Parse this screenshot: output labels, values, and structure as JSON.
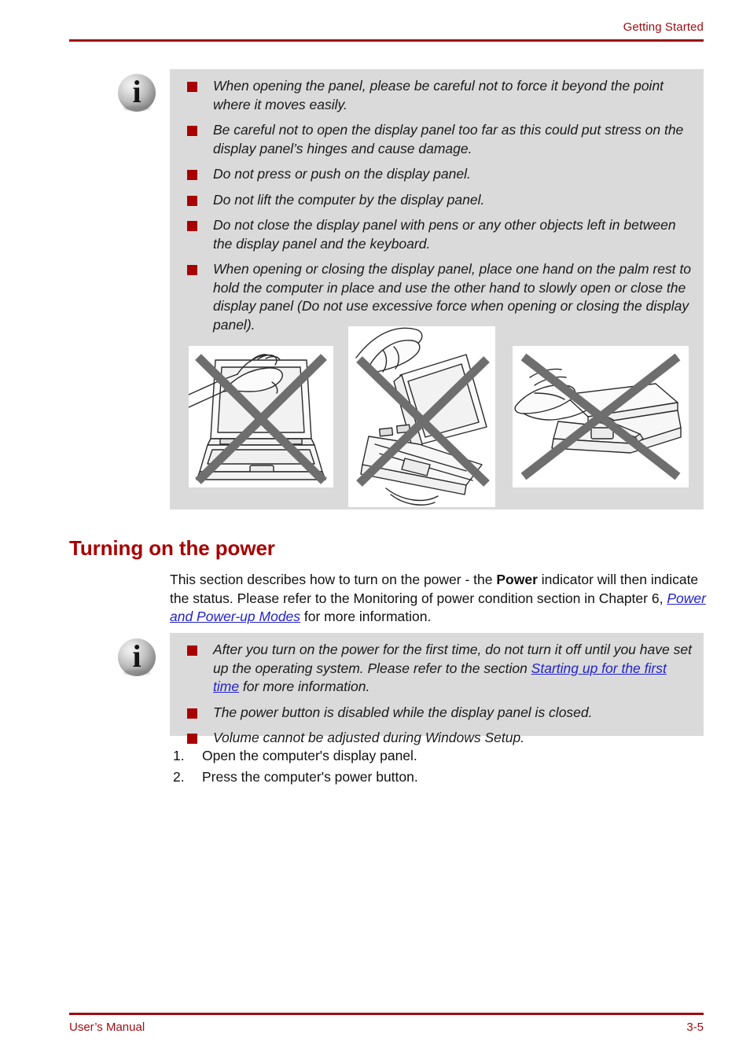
{
  "header": {
    "title": "Getting Started"
  },
  "note_panel_display": {
    "icon_glyph": "i",
    "bullets": [
      "When opening the panel, please be careful not to force it beyond the point where it moves easily.",
      "Be careful not to open the display panel too far as this could put stress on the display panel’s hinges and cause damage.",
      "Do not press or push on the display panel.",
      "Do not lift the computer by the display panel.",
      "Do not close the display panel with pens or any other objects left in between the display panel and the keyboard.",
      "When opening or closing the display panel, place one hand on the palm rest to hold the computer in place and use the other hand to slowly open or close the display panel (Do not use excessive force when opening or closing the display panel)."
    ],
    "figures": [
      {
        "name": "laptop-hand-on-lid-prohibited",
        "caption": ""
      },
      {
        "name": "laptop-lifted-by-display-prohibited",
        "caption": ""
      },
      {
        "name": "laptop-closing-on-pen-prohibited",
        "caption": ""
      }
    ]
  },
  "section": {
    "heading": "Turning on the power",
    "paragraph": {
      "part1": "This section describes how to turn on the power - the ",
      "bold1": "Power",
      "part2": " indicator will then indicate the status. Please refer to the Monitoring of power condition section in Chapter 6, ",
      "link1": "Power and Power-up Modes",
      "part3": " for more information."
    }
  },
  "note_power": {
    "icon_glyph": "i",
    "bullet1": {
      "part1": "After you turn on the power for the first time, do not turn it off until you have set up the operating system. Please refer to the section ",
      "link1": "Starting up for the first time",
      "part2": " for more information."
    },
    "bullet2": "The power button is disabled while the display panel is closed.",
    "bullet3": "Volume cannot be adjusted during Windows Setup."
  },
  "steps": [
    {
      "num": "1.",
      "text": "Open the computer's display panel."
    },
    {
      "num": "2.",
      "text": "Press the computer's power button."
    }
  ],
  "footer": {
    "left": "User’s Manual",
    "right": "3-5"
  },
  "colors": {
    "accent_red": "#9e0b0f",
    "heading_red": "#a80000",
    "bullet_red": "#a80000",
    "note_bg": "#dadada",
    "link_blue": "#2222cc",
    "figure_x_gray": "#6e6e6e"
  }
}
